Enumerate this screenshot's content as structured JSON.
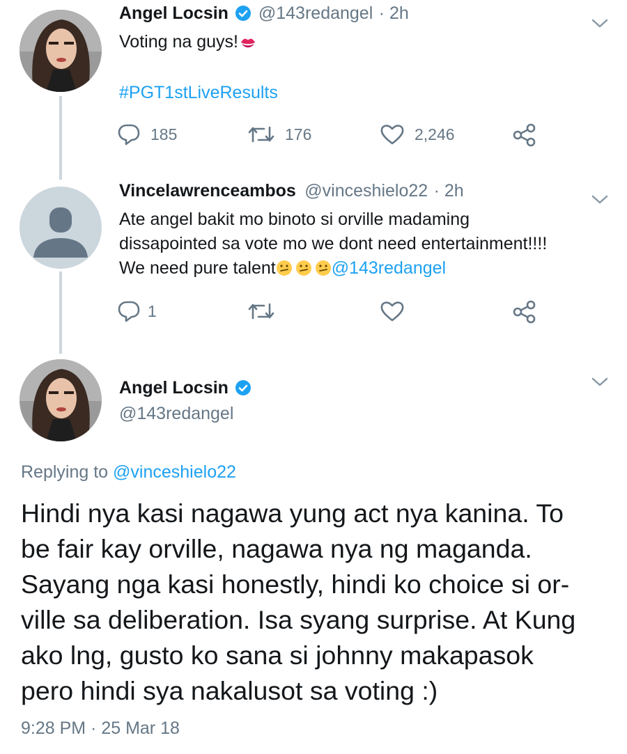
{
  "tweets": [
    {
      "display_name": "Angel Locsin",
      "handle": "@143redangel",
      "time": "· 2h",
      "text": "Voting na guys!",
      "hashtag": "#PGT1stLiveResults",
      "replies": "185",
      "retweets": "176",
      "likes": "2,246"
    },
    {
      "display_name": "Vincelawrenceambos",
      "handle": "@vinceshielo22",
      "time": "· 2h",
      "line1": "Ate angel bakit mo binoto si orville madaming",
      "line2": "dissapointed sa vote mo we dont need entertainment!!!!",
      "line3": "We need pure talent",
      "mention": "@143redangel",
      "replies": "1"
    }
  ],
  "main_tweet": {
    "display_name": "Angel Locsin",
    "handle": "@143redangel",
    "replying_prefix": "Replying to",
    "replying_to": "@vinceshielo22",
    "lines": [
      "Hindi nya kasi nagawa yung act nya kanina. To",
      "be fair kay orville, nagawa nya ng maganda.",
      "Sayang nga kasi honestly, hindi ko choice si or-",
      "ville sa deliberation. Isa syang surprise. At Kung",
      "ako lng, gusto ko sana si johnny makapasok",
      "pero hindi sya nakalusot sa voting :)"
    ],
    "timestamp": "9:28 PM · 25 Mar 18"
  },
  "colors": {
    "link": "#1da1f2",
    "muted": "#657786",
    "thread": "#ccd6dd",
    "verified": "#1da1f2"
  }
}
